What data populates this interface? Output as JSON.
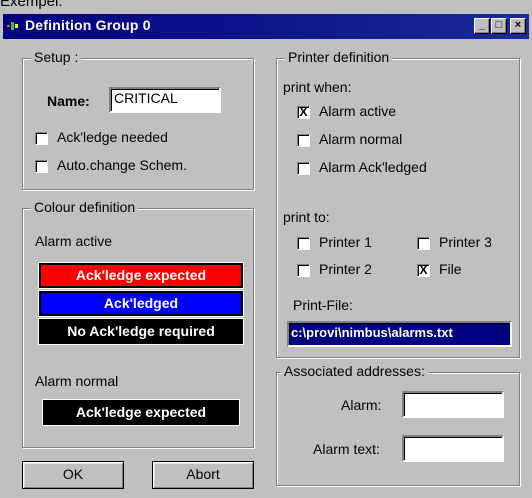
{
  "caption": "Exempel:",
  "window": {
    "title": "Definition Group 0",
    "buttons": {
      "minimize": "_",
      "maximize": "□",
      "close": "×"
    }
  },
  "setup": {
    "legend": "Setup :",
    "name_label": "Name:",
    "name_value": "CRITICAL",
    "ack_needed": {
      "label": "Ack'ledge needed",
      "checked": false
    },
    "auto_change": {
      "label": "Auto.change Schem.",
      "checked": false
    }
  },
  "colour": {
    "legend": "Colour definition",
    "alarm_active_label": "Alarm active",
    "btn_expected": {
      "label": "Ack'ledge expected",
      "bg": "#ff0000",
      "fg": "#ffffff"
    },
    "btn_acknowledged": {
      "label": "Ack'ledged",
      "bg": "#0000ff",
      "fg": "#ffffff"
    },
    "btn_no_ack": {
      "label": "No Ack'ledge required",
      "bg": "#000000",
      "fg": "#ffffff"
    },
    "alarm_normal_label": "Alarm normal",
    "btn_normal_expected": {
      "label": "Ack'ledge expected",
      "bg": "#000000",
      "fg": "#ffffff"
    }
  },
  "printer": {
    "legend": "Printer definition",
    "print_when_label": "print when:",
    "when_active": {
      "label": "Alarm active",
      "checked": true
    },
    "when_normal": {
      "label": "Alarm normal",
      "checked": false
    },
    "when_acked": {
      "label": "Alarm Ack'ledged",
      "checked": false
    },
    "print_to_label": "print to:",
    "printer1": {
      "label": "Printer 1",
      "checked": false
    },
    "printer3": {
      "label": "Printer 3",
      "checked": false
    },
    "printer2": {
      "label": "Printer 2",
      "checked": false
    },
    "file": {
      "label": "File",
      "checked": true
    },
    "print_file_label": "Print-File:",
    "print_file_value": "c:\\provi\\nimbus\\alarms.txt"
  },
  "addresses": {
    "legend": "Associated addresses:",
    "alarm_label": "Alarm:",
    "alarm_value": "",
    "alarm_text_label": "Alarm text:",
    "alarm_text_value": ""
  },
  "actions": {
    "ok": "OK",
    "abort": "Abort"
  },
  "check_mark": "X"
}
